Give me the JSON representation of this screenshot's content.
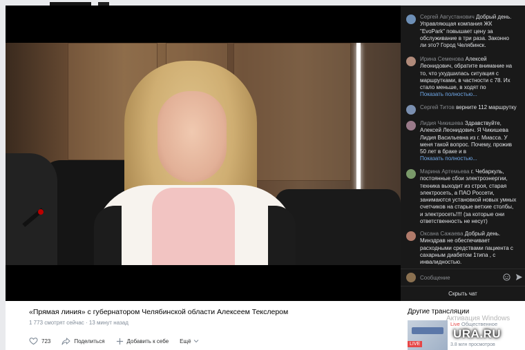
{
  "chat": {
    "messages": [
      {
        "author": "Сергей Августанович",
        "text": "Добрый день. Управляющая компания ЖК \"EvoPark\" повышает цену за обслуживание в три раза. Законно ли это? Город Челябинск.",
        "more": "",
        "avatar_color": "#6d8fb6"
      },
      {
        "author": "Ирина Семенова",
        "text": "Алексей Леонидович, обратите внимание на то, что ухудшилась ситуация с маршрутками, в частности с 78. Их стало меньше, в ходят по",
        "more": "Показать полностью...",
        "avatar_color": "#b08a7a"
      },
      {
        "author": "Сергей Титов",
        "text": "верните 112 маршрутку",
        "more": "",
        "avatar_color": "#7a8fb0"
      },
      {
        "author": "Лидия Чикишева",
        "text": "Здравствуйте, Алексей Леонидович. Я Чикишева Лидия Васильевна из г. Миасса. У меня такой вопрос. Почему, прожив 50 лет в браке и в",
        "more": "Показать полностью...",
        "avatar_color": "#9a7a8a"
      },
      {
        "author": "Марина Артемьева",
        "text": "г. Чебаркуль, постоянные сбои электроэнергии, техника выходит из строя, старая электросеть, а ПАО Россети, занимаются установкой новых умных счетчиков на старые ветхие столбы, и электросеть!!!! (за которые они ответственность не несут)",
        "more": "",
        "avatar_color": "#7a9a6a"
      },
      {
        "author": "Оксана Сажаева",
        "text": "Добрый день. Минздрав не обеспечивает расходными средствами пациента с сахарным диабетом 1типа , с инвалидностью.",
        "more": "",
        "avatar_color": "#b07a6a"
      }
    ],
    "input_placeholder": "Сообщение",
    "hide_label": "Скрыть чат"
  },
  "video": {
    "title": "«Прямая линия» с губернатором Челябинской области Алексеем Текслером",
    "stats": "1 773 смотрят сейчас · 13 минут назад"
  },
  "actions": {
    "likes": "723",
    "share": "Поделиться",
    "add": "Добавить к себе",
    "more": "Ещё"
  },
  "side": {
    "title": "Другие трансляции",
    "live_word": "Live",
    "live_title": "Общественное",
    "live_badge": "LIVE",
    "views": "3.8 млн просмотров",
    "watermark": "Активация Windows",
    "logo": "URA.RU"
  }
}
